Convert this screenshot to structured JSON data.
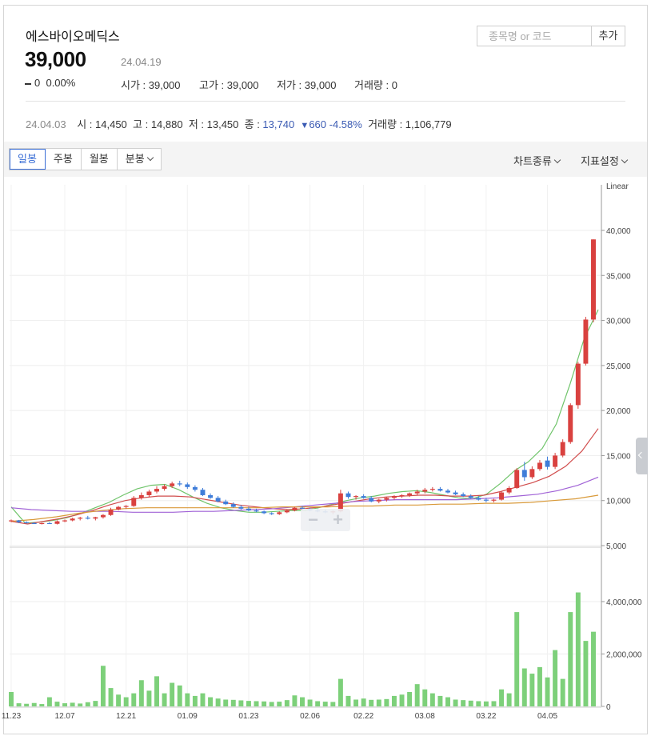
{
  "header": {
    "name": "에스바이오메딕스",
    "price": "39,000",
    "date": "24.04.19",
    "change": "0",
    "change_rate": "0.00%",
    "open": "시가 : 39,000",
    "high": "고가 : 39,000",
    "low": "저가 : 39,000",
    "volume": "거래량 : 0"
  },
  "search": {
    "placeholder": "종목명 or 코드",
    "add_label": "추가"
  },
  "previous_day": {
    "date": "24.04.03",
    "open": "시 : 14,450",
    "high": "고 : 14,880",
    "low": "저 : 13,450",
    "close_label": "종 : ",
    "close": "13,740",
    "triangle": "▼",
    "change": "660",
    "change_rate": "-4.58%",
    "volume": "거래량 : 1,106,779"
  },
  "toolbar": {
    "tabs": [
      "일봉",
      "주봉",
      "월봉",
      "분봉"
    ],
    "chart_type": "차트종류",
    "indicator": "지표설정"
  },
  "colors": {
    "up": "#d9413f",
    "down": "#3f7dd9",
    "volume": "#7dd07a",
    "ma5": "#6fc46a",
    "ma20": "#d14d4d",
    "ma60": "#a062d6",
    "ma120": "#d99a3a",
    "accent": "#3b6fd6"
  },
  "chart_data": {
    "type": "candlestick",
    "scale": "Linear",
    "price_ticks": [
      "40,000",
      "35,000",
      "30,000",
      "25,000",
      "20,000",
      "15,000",
      "10,000",
      "5,000"
    ],
    "volume_ticks": [
      "4,000,000",
      "2,000,000",
      "0"
    ],
    "x_labels": [
      "11.23",
      "12.07",
      "12.21",
      "01.09",
      "01.23",
      "02.06",
      "02.22",
      "03.08",
      "03.22",
      "04.05"
    ],
    "ylim": [
      5000,
      42000
    ],
    "vol_ylim": [
      0,
      5200000
    ],
    "candles": [
      [
        7700,
        7900,
        7600,
        7800
      ],
      [
        7800,
        7850,
        7500,
        7600
      ],
      [
        7600,
        7700,
        7450,
        7500
      ],
      [
        7500,
        7600,
        7400,
        7450
      ],
      [
        7450,
        7550,
        7350,
        7500
      ],
      [
        7500,
        7600,
        7400,
        7420
      ],
      [
        7420,
        7800,
        7350,
        7700
      ],
      [
        7700,
        7900,
        7600,
        7800
      ],
      [
        7800,
        8100,
        7700,
        8000
      ],
      [
        8000,
        8200,
        7800,
        8100
      ],
      [
        8100,
        8300,
        7900,
        8000
      ],
      [
        8000,
        8200,
        7800,
        8150
      ],
      [
        8150,
        8500,
        8000,
        8400
      ],
      [
        8400,
        9200,
        8300,
        9000
      ],
      [
        9000,
        9400,
        8900,
        9300
      ],
      [
        9300,
        9500,
        9100,
        9400
      ],
      [
        9400,
        10500,
        9300,
        10300
      ],
      [
        10300,
        10900,
        10100,
        10600
      ],
      [
        10600,
        11200,
        10400,
        11000
      ],
      [
        11000,
        11600,
        10800,
        11300
      ],
      [
        11300,
        11800,
        11100,
        11600
      ],
      [
        11600,
        12100,
        11400,
        11900
      ],
      [
        11900,
        12200,
        11600,
        11800
      ],
      [
        11800,
        12000,
        11300,
        11500
      ],
      [
        11500,
        11700,
        11000,
        11200
      ],
      [
        11200,
        11400,
        10500,
        10600
      ],
      [
        10600,
        10800,
        10200,
        10300
      ],
      [
        10300,
        10500,
        9800,
        9900
      ],
      [
        9900,
        10100,
        9500,
        9600
      ],
      [
        9600,
        9800,
        9200,
        9300
      ],
      [
        9300,
        9500,
        9000,
        9100
      ],
      [
        9100,
        9300,
        8800,
        8900
      ],
      [
        8900,
        9100,
        8700,
        8800
      ],
      [
        8800,
        8900,
        8500,
        8600
      ],
      [
        8600,
        8700,
        8400,
        8500
      ],
      [
        8500,
        8800,
        8400,
        8700
      ],
      [
        8700,
        9000,
        8600,
        8900
      ],
      [
        8900,
        9300,
        8800,
        9200
      ],
      [
        9200,
        9400,
        9000,
        9100
      ],
      [
        9100,
        9200,
        8800,
        8900
      ],
      [
        8900,
        9100,
        8700,
        8800
      ],
      [
        8800,
        9000,
        8600,
        8700
      ],
      [
        8700,
        8900,
        8500,
        8800
      ],
      [
        8800,
        11200,
        8700,
        10800
      ],
      [
        10800,
        11000,
        10200,
        10400
      ],
      [
        10400,
        10600,
        10100,
        10500
      ],
      [
        10500,
        10700,
        10200,
        10300
      ],
      [
        10300,
        10500,
        9800,
        9900
      ],
      [
        9900,
        10200,
        9700,
        10100
      ],
      [
        10100,
        10400,
        9900,
        10300
      ],
      [
        10300,
        10600,
        10100,
        10500
      ],
      [
        10500,
        10700,
        10300,
        10600
      ],
      [
        10600,
        10900,
        10400,
        10800
      ],
      [
        10800,
        11200,
        10600,
        11000
      ],
      [
        11000,
        11400,
        10800,
        11200
      ],
      [
        11200,
        11500,
        11000,
        11300
      ],
      [
        11300,
        11500,
        11000,
        11100
      ],
      [
        11100,
        11300,
        10800,
        10900
      ],
      [
        10900,
        11100,
        10600,
        10700
      ],
      [
        10700,
        10900,
        10400,
        10500
      ],
      [
        10500,
        10700,
        10200,
        10300
      ],
      [
        10300,
        10500,
        10000,
        10100
      ],
      [
        10100,
        10300,
        9800,
        10000
      ],
      [
        10000,
        10200,
        9800,
        10100
      ],
      [
        10100,
        11000,
        10000,
        10900
      ],
      [
        10900,
        11600,
        10700,
        11400
      ],
      [
        11400,
        13600,
        11300,
        13400
      ],
      [
        13400,
        14300,
        12200,
        12600
      ],
      [
        12600,
        13800,
        12400,
        13500
      ],
      [
        13500,
        14500,
        13300,
        14200
      ],
      [
        14450,
        14880,
        13450,
        13740
      ],
      [
        13740,
        15300,
        13500,
        15000
      ],
      [
        15000,
        16800,
        14800,
        16500
      ],
      [
        16500,
        20800,
        16300,
        20600
      ],
      [
        20600,
        25400,
        20200,
        25200
      ],
      [
        25200,
        30400,
        25000,
        30100
      ],
      [
        30100,
        39000,
        29800,
        39000
      ]
    ],
    "volumes": [
      550000,
      120000,
      100000,
      130000,
      90000,
      350000,
      180000,
      120000,
      140000,
      110000,
      160000,
      210000,
      1550000,
      700000,
      450000,
      350000,
      500000,
      1000000,
      600000,
      1150000,
      500000,
      900000,
      800000,
      500000,
      400000,
      500000,
      350000,
      300000,
      260000,
      250000,
      230000,
      210000,
      200000,
      190000,
      170000,
      180000,
      240000,
      420000,
      350000,
      260000,
      200000,
      180000,
      170000,
      1050000,
      400000,
      260000,
      300000,
      250000,
      260000,
      280000,
      400000,
      450000,
      550000,
      850000,
      650000,
      500000,
      400000,
      350000,
      260000,
      240000,
      220000,
      200000,
      190000,
      200000,
      650000,
      500000,
      3600000,
      1450000,
      1250000,
      1500000,
      1106779,
      2150000,
      1050000,
      3600000,
      4350000,
      2500000,
      2850000
    ],
    "moving_averages": [
      {
        "name": "ma5",
        "start": 9300,
        "points": [
          7500,
          7600,
          7800,
          8100,
          8600,
          9200,
          9800,
          10600,
          11300,
          11700,
          11800,
          11200,
          10400,
          9700,
          9200,
          8900,
          8700,
          8700,
          8800,
          8900,
          8900,
          9200,
          9600,
          10000,
          10300,
          10500,
          10800,
          11000,
          11100,
          10900,
          10600,
          10300,
          10200,
          10700,
          11900,
          13300,
          14300,
          15800,
          18500,
          23000,
          28000,
          31200
        ]
      },
      {
        "name": "ma20",
        "start": 7700,
        "points": [
          7400,
          7700,
          8000,
          8400,
          8900,
          9500,
          10000,
          10300,
          10500,
          10500,
          10400,
          10100,
          9800,
          9500,
          9300,
          9100,
          9000,
          9100,
          9300,
          9600,
          9900,
          10200,
          10400,
          10500,
          10600,
          10600,
          10500,
          10500,
          10600,
          11000,
          11500,
          12000,
          12700,
          13800,
          15500,
          18000
        ]
      },
      {
        "name": "ma60",
        "start": 9200,
        "points": [
          9000,
          8900,
          8800,
          8800,
          8800,
          8700,
          8700,
          8700,
          8800,
          8800,
          8900,
          9000,
          9100,
          9300,
          9500,
          9700,
          9900,
          10000,
          10100,
          10100,
          10100,
          10100,
          10200,
          10300,
          10500,
          10700,
          11100,
          11700,
          12600
        ]
      },
      {
        "name": "ma120",
        "start": 7700,
        "points": [
          7900,
          8200,
          8600,
          8900,
          9100,
          9200,
          9200,
          9200,
          9200,
          9200,
          9200,
          9300,
          9300,
          9300,
          9400,
          9400,
          9500,
          9500,
          9600,
          9600,
          9700,
          9700,
          9800,
          10000,
          10200,
          10600
        ]
      }
    ]
  }
}
